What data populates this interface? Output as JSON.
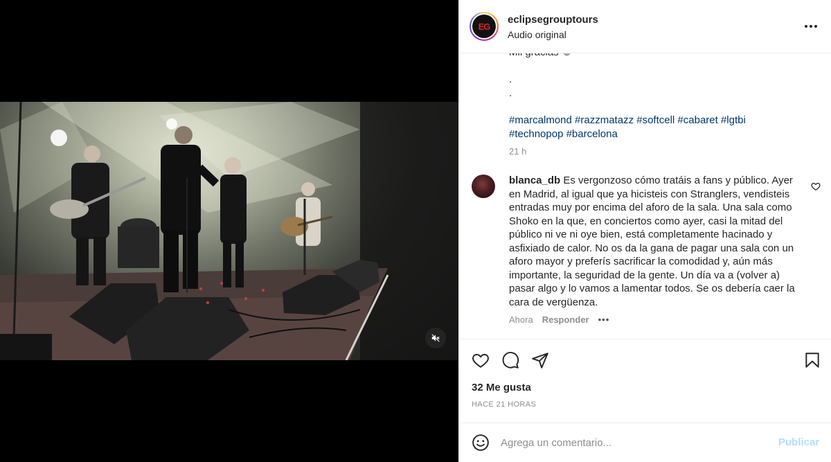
{
  "header": {
    "username": "eclipsegrouptours",
    "subtitle": "Audio original",
    "avatar_logo": "EG",
    "more_icon": "more-horizontal-icon"
  },
  "caption": {
    "partial_line": "Mil gracias ☺",
    "dot1": ".",
    "dot2": ".",
    "hashtags": "#marcalmond #razzmatazz #softcell #cabaret #lgtbi #technopop #barcelona",
    "time": "21 h"
  },
  "comment": {
    "username": "blanca_db",
    "text": "Es vergonzoso cómo tratáis a fans y público. Ayer en Madrid, al igual que ya hicisteis con Stranglers, vendisteis entradas muy por encima del aforo de la sala. Una sala como Shoko en la que, en conciertos como ayer, casi la mitad del público ni ve ni oye bien, está completamente hacinado y asfixiado de calor. No os da la gana de pagar una sala con un aforo mayor y preferís sacrificar la comodidad y, aún más importante, la seguridad de la gente. Un día va a (volver a) pasar algo y lo vamos a lamentar todos. Se os debería caer la cara de vergüenza.",
    "time": "Ahora",
    "reply_label": "Responder",
    "options": "•••"
  },
  "actions": {
    "likes": "32 Me gusta",
    "posted_ago": "HACE 21 HORAS"
  },
  "composer": {
    "placeholder": "Agrega un comentario...",
    "post_label": "Publicar",
    "post_color": "#b2dffc"
  },
  "colors": {
    "hashtag": "#00376b",
    "muted": "#8e8e8e",
    "text": "#262626"
  }
}
